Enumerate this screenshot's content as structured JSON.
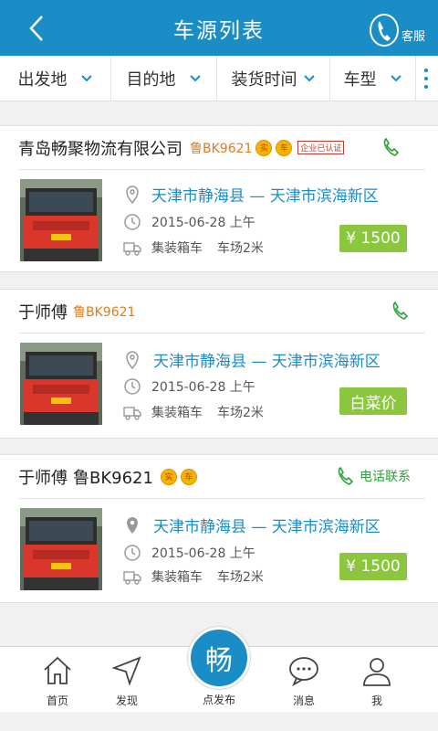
{
  "header": {
    "title": "车源列表",
    "service_label": "客服"
  },
  "filters": [
    {
      "label": "出发地"
    },
    {
      "label": "目的地"
    },
    {
      "label": "装货时间"
    },
    {
      "label": "车型"
    }
  ],
  "listings": [
    {
      "owner": "青岛畅聚物流有限公司",
      "plate": "鲁BK9621",
      "badges": [
        "实",
        "车"
      ],
      "certification": "企业已认证",
      "route": "天津市静海县 — 天津市滨海新区",
      "date": "2015-06-28 上午",
      "truck_type": "集装箱车",
      "length": "车场2米",
      "price": "¥ 1500"
    },
    {
      "owner": "于师傅",
      "plate": "鲁BK9621",
      "route": "天津市静海县 — 天津市滨海新区",
      "date": "2015-06-28 上午",
      "truck_type": "集装箱车",
      "length": "车场2米",
      "price": "白菜价"
    },
    {
      "owner": "于师傅",
      "plate": "鲁BK9621",
      "badges": [
        "实",
        "车"
      ],
      "call_label": "电话联系",
      "route": "天津市静海县 — 天津市滨海新区",
      "date": "2015-06-28 上午",
      "truck_type": "集装箱车",
      "length": "车场2米",
      "price": "¥ 1500"
    }
  ],
  "tabs": {
    "home": "首页",
    "discover": "发现",
    "publish_char": "畅",
    "publish": "点发布",
    "messages": "消息",
    "me": "我"
  },
  "colors": {
    "primary": "#1a8cc6",
    "price_green": "#8cc63f",
    "call_green": "#2aa236",
    "plate_orange": "#e07b1f"
  }
}
